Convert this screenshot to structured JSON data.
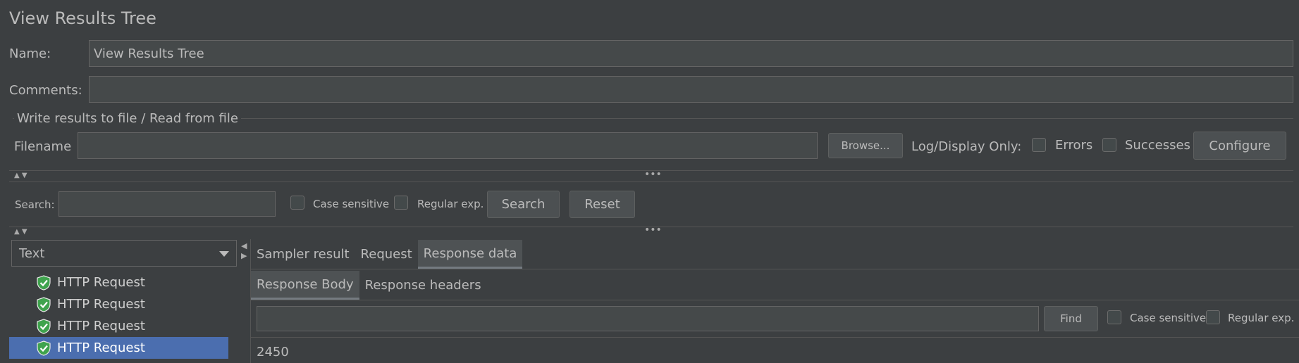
{
  "header": {
    "title": "View Results Tree"
  },
  "form": {
    "name_label": "Name:",
    "name_value": "View Results Tree",
    "comments_label": "Comments:",
    "comments_value": ""
  },
  "file_section": {
    "legend": "Write results to file / Read from file",
    "filename_label": "Filename",
    "filename_value": "",
    "browse_label": "Browse...",
    "log_display_label": "Log/Display Only:",
    "errors_label": "Errors",
    "successes_label": "Successes",
    "configure_label": "Configure"
  },
  "search": {
    "label": "Search:",
    "value": "",
    "case_sensitive_label": "Case sensitive",
    "regex_label": "Regular exp.",
    "search_button": "Search",
    "reset_button": "Reset"
  },
  "renderer": {
    "selected": "Text"
  },
  "tree": {
    "items": [
      {
        "label": "HTTP Request",
        "selected": false
      },
      {
        "label": "HTTP Request",
        "selected": false
      },
      {
        "label": "HTTP Request",
        "selected": false
      },
      {
        "label": "HTTP Request",
        "selected": true
      }
    ]
  },
  "result_tabs": {
    "sampler_result": "Sampler result",
    "request": "Request",
    "response_data": "Response data"
  },
  "response_tabs": {
    "body": "Response Body",
    "headers": "Response headers"
  },
  "find": {
    "value": "",
    "button": "Find",
    "case_sensitive_label": "Case sensitive",
    "regex_label": "Regular exp."
  },
  "response_body": {
    "text": "2450"
  },
  "colors": {
    "background": "#3c3f41",
    "selection": "#4b6eaf",
    "success_shield": "#3fa34d"
  }
}
